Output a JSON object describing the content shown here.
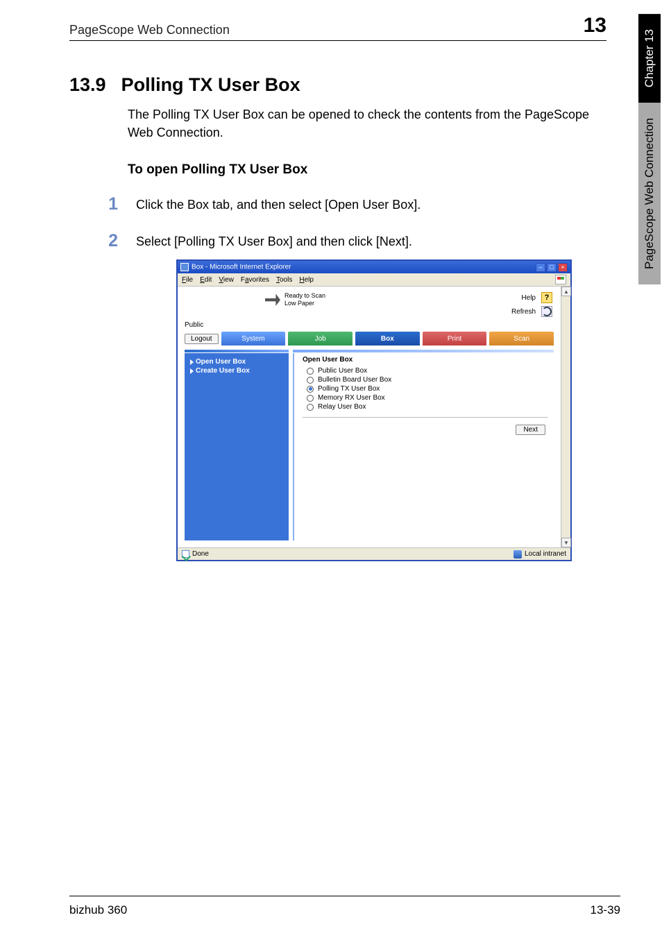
{
  "side_tabs": {
    "top": "Chapter 13",
    "bottom": "PageScope Web Connection"
  },
  "header": {
    "left": "PageScope Web Connection",
    "right": "13"
  },
  "section": {
    "number": "13.9",
    "title": "Polling TX User Box"
  },
  "intro": "The Polling TX User Box can be opened to check the contents from the PageScope Web Connection.",
  "subheading": "To open Polling TX User Box",
  "steps": [
    {
      "num": "1",
      "text": "Click the Box tab, and then select [Open User Box]."
    },
    {
      "num": "2",
      "text": "Select [Polling TX User Box] and then click [Next]."
    }
  ],
  "browser": {
    "title": "Box - Microsoft Internet Explorer",
    "menus": [
      {
        "u": "F",
        "rest": "ile"
      },
      {
        "u": "E",
        "rest": "dit"
      },
      {
        "u": "V",
        "rest": "iew"
      },
      {
        "u": "",
        "rest": "F",
        "u2": "a",
        "rest2": "vorites"
      },
      {
        "u": "T",
        "rest": "ools"
      },
      {
        "u": "H",
        "rest": "elp"
      }
    ],
    "menu_labels": [
      "File",
      "Edit",
      "View",
      "Favorites",
      "Tools",
      "Help"
    ],
    "status": {
      "line1": "Ready to Scan",
      "line2": "Low Paper"
    },
    "help_label": "Help",
    "refresh_label": "Refresh",
    "user": "Public",
    "logout": "Logout",
    "tabs": {
      "system": "System",
      "job": "Job",
      "box": "Box",
      "print": "Print",
      "scan": "Scan"
    },
    "side_items": [
      "Open User Box",
      "Create User Box"
    ],
    "panel_title": "Open User Box",
    "radios": [
      {
        "label": "Public User Box",
        "selected": false
      },
      {
        "label": "Bulletin Board User Box",
        "selected": false
      },
      {
        "label": "Polling TX User Box",
        "selected": true
      },
      {
        "label": "Memory RX User Box",
        "selected": false
      },
      {
        "label": "Relay User Box",
        "selected": false
      }
    ],
    "next": "Next",
    "statusbar_done": "Done",
    "statusbar_zone": "Local intranet"
  },
  "footer": {
    "left": "bizhub 360",
    "right": "13-39"
  }
}
